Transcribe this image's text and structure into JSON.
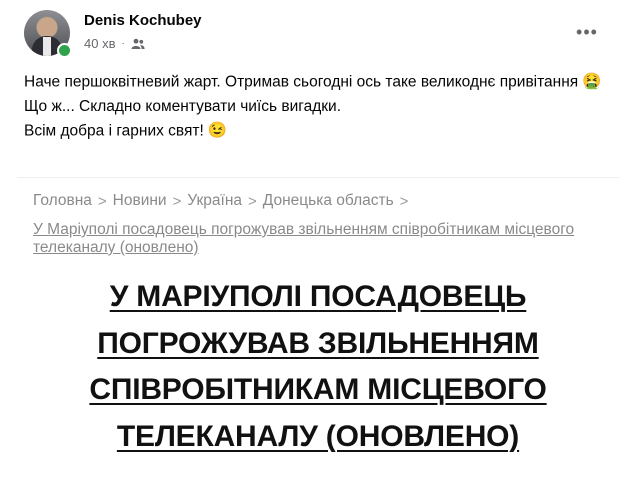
{
  "post": {
    "author": "Denis Kochubey",
    "time": "40 хв",
    "separator": "·",
    "audience_icon": "friends-icon",
    "more_icon": "more-horizontal-icon",
    "more_label": "•••",
    "lines": [
      "Наче першоквітневий жарт. Отримав сьогодні ось таке великоднє привітання",
      "Що ж... Складно коментувати чиїсь вигадки.",
      "Всім добра і гарних свят!"
    ],
    "emoji_1": "🤮",
    "emoji_2": "😉"
  },
  "article": {
    "breadcrumb": [
      "Головна",
      "Новини",
      "Україна",
      "Донецька область"
    ],
    "breadcrumb_separator": ">",
    "breadcrumb_current": "У Маріуполі посадовець погрожував звільненням співробітникам місцевого телеканалу (оновлено)",
    "headline": "У МАРІУПОЛІ ПОСАДОВЕЦЬ ПОГРОЖУВАВ ЗВІЛЬНЕННЯМ СПІВРОБІТНИКАМ МІСЦЕВОГО ТЕЛЕКАНАЛУ (ОНОВЛЕНО)"
  },
  "colors": {
    "online": "#31a24c",
    "meta": "#65676b",
    "breadcrumb": "#8a8a8a"
  }
}
